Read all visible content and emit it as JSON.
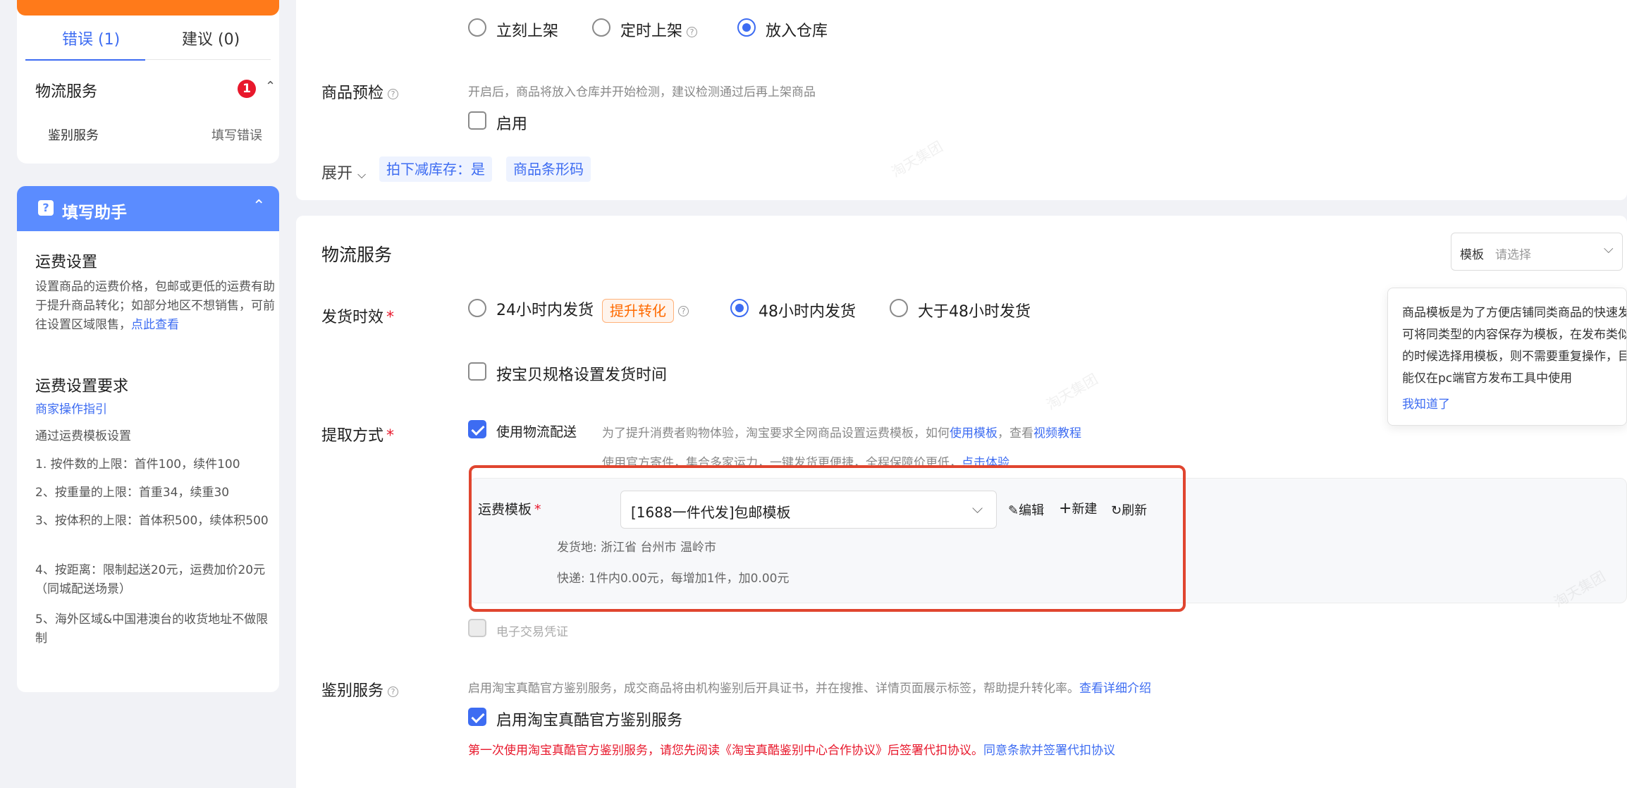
{
  "error_panel": {
    "tabs": [
      {
        "label": "错误 (1)"
      },
      {
        "label": "建议 (0)"
      }
    ],
    "section_title": "物流服务",
    "badge_count": "1",
    "item_name": "鉴别服务",
    "item_status": "填写错误"
  },
  "helper": {
    "title": "填写助手",
    "freight_title": "运费设置",
    "freight_desc": "设置商品的运费价格，包邮或更低的运费有助于提升商品转化；如部分地区不想销售，可前往设置区域限售，",
    "freight_link": "点此查看",
    "req_title": "运费设置要求",
    "req_link": "商家操作指引",
    "req_intro": "通过运费模板设置",
    "rules": [
      "1. 按件数的上限：首件100，续件100",
      "2、按重量的上限：首重34，续重30",
      "3、按体积的上限：首体积500，续体积500",
      "4、按距离：限制起送20元，运费加价20元（同城配送场景）",
      "5、海外区域&中国港澳台的收货地址不做限制"
    ]
  },
  "listing": {
    "options": [
      "立刻上架",
      "定时上架",
      "放入仓库"
    ],
    "selected": "放入仓库"
  },
  "precheck": {
    "label": "商品预检",
    "desc": "开启后，商品将放入仓库并开始检测，建议检测通过后再上架商品",
    "checkbox_label": "启用"
  },
  "expand": {
    "label": "展开",
    "tags": [
      "拍下减库存：是",
      "商品条形码"
    ]
  },
  "logistics": {
    "title": "物流服务",
    "template_select": {
      "label": "模板",
      "placeholder": "请选择"
    },
    "tooltip": {
      "text": "商品模板是为了方便店铺同类商品的快速发布，可将同类型的内容保存为模板，在发布类似商品的时候选择用模板，则不需要重复操作，目前功能仅在pc端官方发布工具中使用",
      "ok": "我知道了"
    },
    "ship_time": {
      "label": "发货时效",
      "options": [
        "24小时内发货",
        "48小时内发货",
        "大于48小时发货"
      ],
      "badge": "提升转化",
      "selected": "48小时内发货",
      "per_sku": "按宝贝规格设置发货时间"
    },
    "pickup": {
      "label": "提取方式",
      "use_logistics": "使用物流配送",
      "note": "为了提升消费者购物体验，淘宝要求全网商品设置运费模板，如何",
      "note_link1": "使用模板",
      "note_mid": "，查看",
      "note_link2": "视频教程",
      "note2": "使用官方寄件，集合多家运力，一键发货更便捷，全程保障价更低，",
      "note2_link": "点击体验",
      "freight_label": "运费模板",
      "freight_value": "[1688一件代发]包邮模板",
      "edit": "编辑",
      "create": "新建",
      "refresh": "刷新",
      "origin": "发货地: 浙江省 台州市 温岭市",
      "express": "快递: 1件内0.00元，每增加1件，加0.00元",
      "e_voucher": "电子交易凭证"
    },
    "authentication": {
      "label": "鉴别服务",
      "desc": "启用淘宝真酷官方鉴别服务，成交商品将由机构鉴别后开具证书，并在搜推、详情页面展示标签，帮助提升转化率。",
      "desc_link": "查看详细介绍",
      "checkbox_label": "启用淘宝真酷官方鉴别服务",
      "warning": "第一次使用淘宝真酷官方鉴别服务，请您先阅读《淘宝真酷鉴别中心合作协议》后签署代扣协议。",
      "warning_link": "同意条款并签署代扣协议"
    }
  },
  "colors": {
    "primary": "#3d6cf2",
    "orange": "#ff7a1a",
    "red": "#e0452f",
    "helper_blue": "#5b8cff"
  }
}
